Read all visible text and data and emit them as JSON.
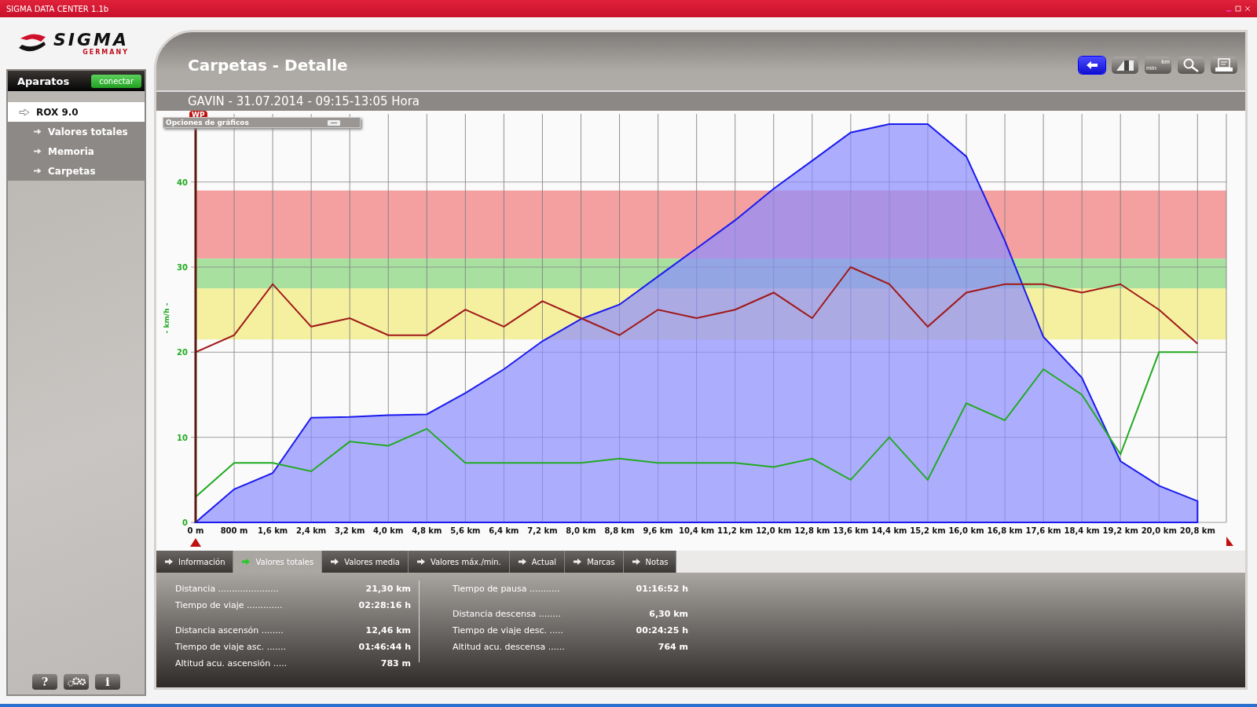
{
  "window": {
    "title": "SIGMA DATA CENTER 1.1b"
  },
  "logo": {
    "name": "SIGMA",
    "tagline": "GERMANY"
  },
  "sidebar": {
    "header": "Aparatos",
    "connect_button": "conectar",
    "items": [
      {
        "label": "ROX 9.0",
        "selected": true,
        "children": [
          {
            "label": "Valores totales",
            "selected": false
          },
          {
            "label": "Memoria",
            "selected": false
          },
          {
            "label": "Carpetas",
            "selected": false
          }
        ]
      }
    ],
    "footer_buttons": [
      {
        "kind": "help",
        "glyph": "?"
      },
      {
        "kind": "settings"
      },
      {
        "kind": "info",
        "glyph": "i"
      }
    ]
  },
  "page": {
    "title": "Carpetas - Detalle",
    "subtitle": "GAVIN - 31.07.2014 - 09:15-13:05 Hora"
  },
  "toolbar": [
    {
      "kind": "back",
      "selected": true
    },
    {
      "kind": "chart",
      "selected": false
    },
    {
      "kind": "units",
      "labels": [
        "km",
        "min"
      ],
      "selected": false
    },
    {
      "kind": "zoom",
      "selected": false
    },
    {
      "kind": "print",
      "selected": false
    }
  ],
  "chart_options": {
    "title": "Opciones de gráficos",
    "expanded": false
  },
  "waypoint": "WP",
  "chart_data": {
    "type": "line",
    "ylabel": "- km/h -",
    "categories": [
      "0 m",
      "800 m",
      "1,6 km",
      "2,4 km",
      "3,2 km",
      "4,0 km",
      "4,8 km",
      "5,6 km",
      "6,4 km",
      "7,2 km",
      "8,0 km",
      "8,8 km",
      "9,6 km",
      "10,4 km",
      "11,2 km",
      "12,0 km",
      "12,8 km",
      "13,6 km",
      "14,4 km",
      "15,2 km",
      "16,0 km",
      "16,8 km",
      "17,6 km",
      "18,4 km",
      "19,2 km",
      "20,0 km",
      "20,8 km"
    ],
    "ylim": [
      0,
      48
    ],
    "yticks": [
      0,
      10,
      20,
      30,
      40
    ],
    "grid": true,
    "series": [
      {
        "type": "area",
        "color": "#1a1aee",
        "values": [
          0,
          3.9,
          5.8,
          12.3,
          12.4,
          12.6,
          12.7,
          15.2,
          18,
          21.3,
          23.9,
          25.6,
          28.9,
          32.2,
          35.5,
          39.2,
          42.5,
          45.8,
          46.8,
          46.8,
          43,
          33.1,
          21.8,
          17,
          7.2,
          4.3,
          2.5
        ]
      },
      {
        "color": "#a01818",
        "values": [
          20,
          22,
          28,
          23,
          24,
          22,
          22,
          25,
          23,
          26,
          24,
          22,
          25,
          24,
          25,
          27,
          24,
          30,
          28,
          23,
          27,
          28,
          28,
          27,
          28,
          25,
          21
        ]
      },
      {
        "color": "#22aa22",
        "values": [
          3,
          7,
          7,
          6,
          9.5,
          9,
          11,
          7,
          7,
          7,
          7,
          7.5,
          7,
          7,
          7,
          6.5,
          7.5,
          5,
          10,
          5,
          14,
          12,
          18,
          15,
          8,
          20,
          20
        ]
      }
    ],
    "bands": [
      {
        "axis": "y",
        "from": 31,
        "to": 39,
        "color": "#f4a0a0"
      },
      {
        "axis": "y",
        "from": 27.5,
        "to": 31,
        "color": "#a8e0a0"
      },
      {
        "axis": "y",
        "from": 21.5,
        "to": 27.5,
        "color": "#f4f0a0"
      }
    ]
  },
  "tabs": [
    {
      "label": "Información",
      "selected": false
    },
    {
      "label": "Valores totales",
      "selected": true
    },
    {
      "label": "Valores media",
      "selected": false
    },
    {
      "label": "Valores máx./min.",
      "selected": false
    },
    {
      "label": "Actual",
      "selected": false
    },
    {
      "label": "Marcas",
      "selected": false
    },
    {
      "label": "Notas",
      "selected": false
    }
  ],
  "stats": [
    {
      "groups": [
        [
          {
            "label": "Distancia ......................",
            "value": "21,30 km"
          },
          {
            "label": "Tiempo de viaje .............",
            "value": "02:28:16 h"
          }
        ],
        [
          {
            "label": "Distancia ascensón  ........",
            "value": "12,46 km"
          },
          {
            "label": "Tiempo de viaje asc. .......",
            "value": "01:46:44 h"
          },
          {
            "label": "Altitud acu. ascensión .....",
            "value": "783 m"
          }
        ]
      ]
    },
    {
      "groups": [
        [
          {
            "label": "Tiempo de pausa ...........",
            "value": "01:16:52 h"
          }
        ],
        [
          {
            "label": "Distancia descensa  ........",
            "value": "6,30 km"
          },
          {
            "label": "Tiempo de viaje desc. .....",
            "value": "00:24:25 h"
          },
          {
            "label": "Altitud acu. descensa ......",
            "value": "764 m"
          }
        ]
      ]
    }
  ]
}
